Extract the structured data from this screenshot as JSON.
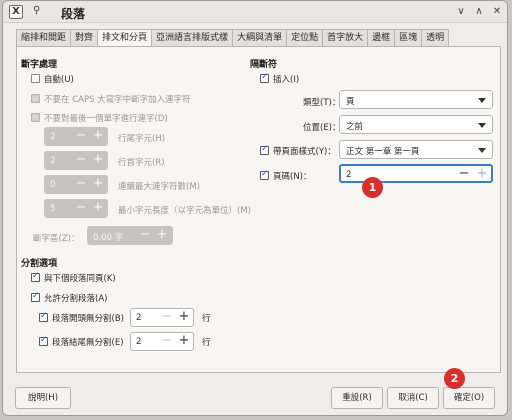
{
  "window": {
    "title": "段落",
    "app_icon_glyph": "X",
    "pin_glyph": "⚲",
    "minimize_glyph": "∨",
    "maximize_glyph": "∧",
    "close_glyph": "✕"
  },
  "tabs": [
    "縮排和間距",
    "對齊",
    "排文和分頁",
    "亞洲語言排版式樣",
    "大綱與清單",
    "定位點",
    "首字放大",
    "邊框",
    "區塊",
    "透明"
  ],
  "active_tab": "排文和分頁",
  "hyphenation": {
    "heading": "斷字處理",
    "auto_label": "自動(U)",
    "caps_label": "不要在 CAPS 大寫字中斷字加入連字符",
    "last_word_label": "不要對最後一個單字進行連字(D)",
    "line_end_value": "2",
    "line_end_label": "行尾字元(H)",
    "line_begin_value": "2",
    "line_begin_label": "行首字元(R)",
    "max_consec_value": "0",
    "max_consec_label": "連續最大連字符數(M)",
    "min_word_value": "5",
    "min_word_label": "最小字元長度（以字元為單位）(M)",
    "zone_label": "斷字區(Z)：",
    "zone_value": "0.00 字"
  },
  "breaks": {
    "heading": "隔斷符",
    "insert_label": "插入(I)",
    "type_label": "類型(T)：",
    "type_value": "頁",
    "position_label": "位置(E)：",
    "position_value": "之前",
    "style_label": "帶頁面樣式(Y)：",
    "style_value": "正文 第一章 第一頁",
    "page_num_label": "頁碼(N)：",
    "page_num_value": "2"
  },
  "split": {
    "heading": "分割選項",
    "keep_next_label": "與下個段落同頁(K)",
    "allow_split_label": "允許分割段落(A)",
    "orphan_label": "段落開頭無分割(B)",
    "orphan_value": "2",
    "widow_label": "段落結尾無分割(E)",
    "widow_value": "2",
    "lines_unit": "行"
  },
  "buttons": {
    "help": "說明(H)",
    "reset": "重設(R)",
    "cancel": "取消(C)",
    "ok": "確定(O)"
  },
  "annotations": [
    "1",
    "2"
  ],
  "colors": {
    "badge": "#d92f2a",
    "focus": "#3a7bd5"
  }
}
